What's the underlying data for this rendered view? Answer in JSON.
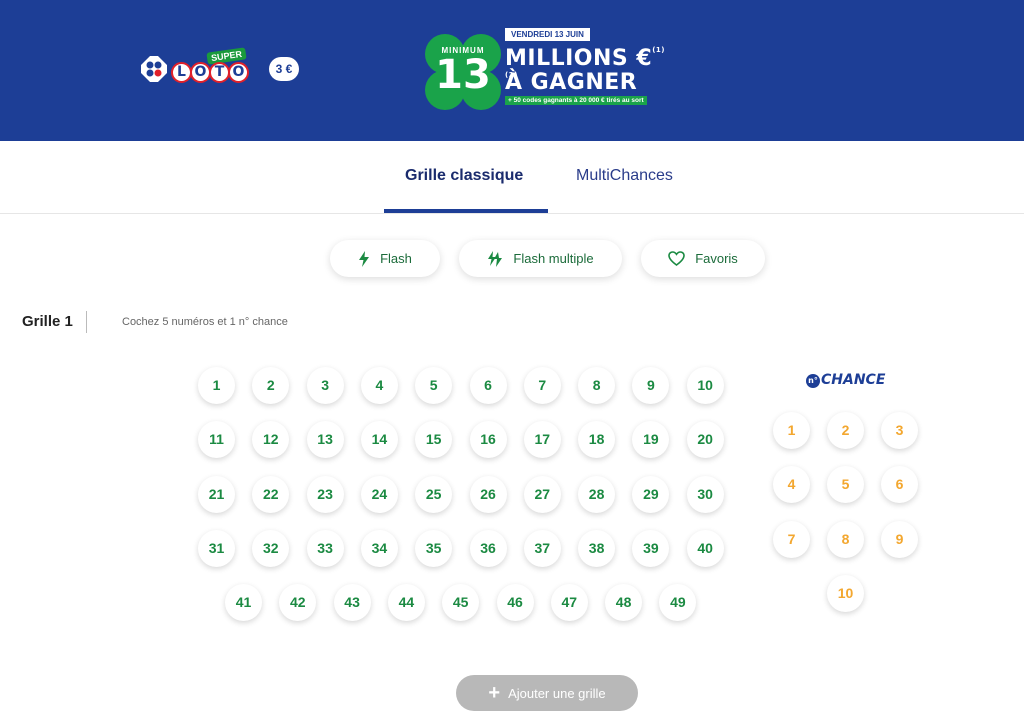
{
  "header": {
    "brand": {
      "super_label": "SUPER",
      "loto_letters": [
        "L",
        "O",
        "T",
        "O"
      ],
      "price": "3 €",
      "fdj_icon": "fdj-clover-logo-icon"
    },
    "promo": {
      "date": "VENDREDI 13 JUIN",
      "minimum_label": "MINIMUM",
      "amount": "13",
      "line1": "MILLIONS €",
      "line1_sup": "(1)(2)",
      "line2": "À GAGNER",
      "subline": "+ 50 codes gagnants à 20 000 € tirés au sort"
    }
  },
  "tabs": [
    {
      "label": "Grille classique",
      "active": true
    },
    {
      "label": "MultiChances",
      "active": false
    }
  ],
  "tools": [
    {
      "label": "Flash",
      "icon": "lightning-icon"
    },
    {
      "label": "Flash multiple",
      "icon": "double-lightning-icon"
    },
    {
      "label": "Favoris",
      "icon": "heart-icon"
    }
  ],
  "grid": {
    "title": "Grille 1",
    "hint": "Cochez 5 numéros et 1 n° chance",
    "main_numbers": [
      1,
      2,
      3,
      4,
      5,
      6,
      7,
      8,
      9,
      10,
      11,
      12,
      13,
      14,
      15,
      16,
      17,
      18,
      19,
      20,
      21,
      22,
      23,
      24,
      25,
      26,
      27,
      28,
      29,
      30,
      31,
      32,
      33,
      34,
      35,
      36,
      37,
      38,
      39,
      40,
      41,
      42,
      43,
      44,
      45,
      46,
      47,
      48,
      49
    ],
    "chance_label": "CHANCE",
    "chance_prefix": "n°",
    "chance_numbers": [
      1,
      2,
      3,
      4,
      5,
      6,
      7,
      8,
      9,
      10
    ]
  },
  "actions": {
    "add_grid_label": "Ajouter une grille"
  },
  "colors": {
    "banner": "#1d3e96",
    "main_number": "#1b8a42",
    "chance_number": "#f3a72f",
    "add_button": "#b8b8b8"
  }
}
